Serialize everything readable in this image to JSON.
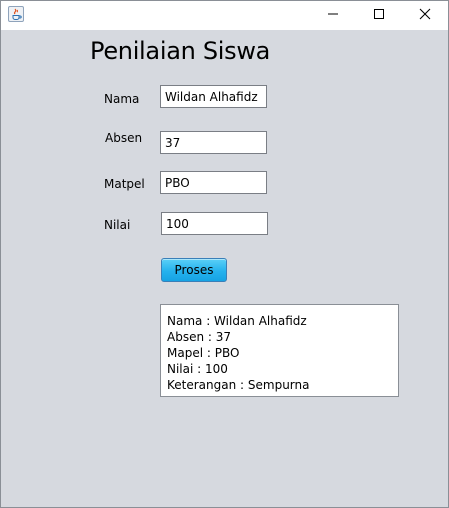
{
  "window": {
    "minimize_icon": "minimize-icon",
    "maximize_icon": "maximize-icon",
    "close_icon": "close-icon",
    "app_icon": "java-icon"
  },
  "form": {
    "title": "Penilaian Siswa",
    "nama_label": "Nama",
    "nama_value": "Wildan Alhafidz",
    "absen_label": "Absen",
    "absen_value": "37",
    "matpel_label": "Matpel",
    "matpel_value": "PBO",
    "nilai_label": "Nilai",
    "nilai_value": "100",
    "proses_label": "Proses"
  },
  "output": {
    "lines": [
      "Nama : Wildan Alhafidz",
      "Absen : 37",
      "Mapel : PBO",
      "Nilai : 100",
      "Keterangan : Sempurna"
    ]
  },
  "colors": {
    "content_bg": "#d6d9df",
    "button_accent": "#25b2ee"
  }
}
